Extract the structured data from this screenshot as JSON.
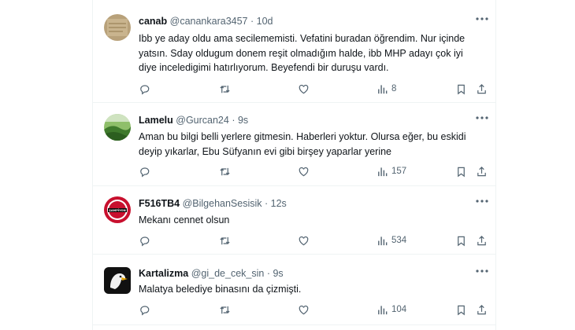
{
  "tweets": [
    {
      "name": "canab",
      "handle": "@canankara3457",
      "time": "10d",
      "text": "Ibb ye aday oldu ama secilememisti. Vefatini buradan öğrendim. Nur içinde yatsın. Sday oldugum donem reşit olmadığım halde, ibb MHP adayı çok iyi diye inceledigimi hatırlıyorum. Beyefendi bir duruşu vardı.",
      "views": "8"
    },
    {
      "name": "Lamelu",
      "handle": "@Gurcan24",
      "time": "9s",
      "text": "Aman bu bilgi belli yerlere gitmesin. Haberleri yoktur. Olursa eğer, bu eskidi deyip yıkarlar, Ebu Süfyanın evi gibi birşey yaparlar yerine",
      "views": "157"
    },
    {
      "name": "F516TB4",
      "handle": "@BilgehanSesisik",
      "time": "12s",
      "text": "Mekanı cennet olsun",
      "views": "534"
    },
    {
      "name": "Kartalizma",
      "handle": "@gi_de_cek_sin",
      "time": "9s",
      "text": "Malatya belediye binasını da çizmişti.",
      "views": "104"
    }
  ],
  "avatar_badge_text": "ŞAMPİYON",
  "icons": [
    "more-icon",
    "reply-icon",
    "retweet-icon",
    "like-icon",
    "views-icon",
    "bookmark-icon",
    "share-icon"
  ],
  "colors": {
    "text": "#0f1419",
    "secondary": "#536471",
    "divider": "#eff3f4"
  }
}
